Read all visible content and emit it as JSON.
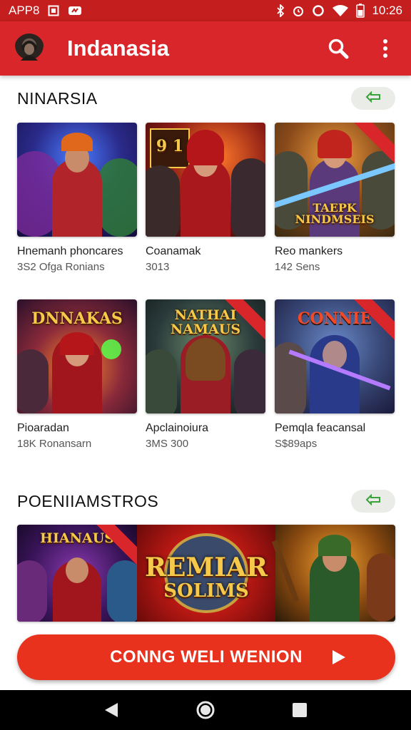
{
  "status_bar": {
    "left_label": "APP8",
    "time": "10:26",
    "icons": [
      "square-icon",
      "cloud-icon",
      "bluetooth-icon",
      "alarm-icon",
      "circle-icon",
      "wifi-icon",
      "battery-icon"
    ]
  },
  "app_bar": {
    "title": "Indanasia",
    "icons": [
      "avatar-icon",
      "search-icon",
      "more-vert-icon"
    ],
    "background": "#d8262a"
  },
  "section1": {
    "title": "NINARSIA",
    "more_icon": "arrow-icon",
    "cards": [
      {
        "title": "Hnemanh phoncares",
        "subtitle": "3S2 Ofga Ronians",
        "art_text": ""
      },
      {
        "title": "Coanamak",
        "subtitle": "3013",
        "art_text": "9 1"
      },
      {
        "title": "Reo mankers",
        "subtitle": "142 Sens",
        "art_text": "TAEPK NINDMSEIS"
      },
      {
        "title": "Pioaradan",
        "subtitle": "18K Ronansarn",
        "art_text": "DNNAKAS"
      },
      {
        "title": "Apclainoiura",
        "subtitle": "3MS 300",
        "art_text": "NATHAI NAMAUS"
      },
      {
        "title": "Pemqla feacansal",
        "subtitle": "S$89aps",
        "art_text": "CONNIE"
      }
    ]
  },
  "section2": {
    "title": "POENIIAMSTROS",
    "more_icon": "arrow-icon",
    "banner": {
      "left_text": "HIANAUS",
      "center_text_line1": "REMIAR",
      "center_text_line2": "SOLIMS"
    }
  },
  "cta": {
    "label": "CONNG WELI WENION",
    "color": "#e8321d"
  },
  "nav_bar": {
    "icons": [
      "back-icon",
      "home-icon",
      "recents-icon"
    ]
  }
}
